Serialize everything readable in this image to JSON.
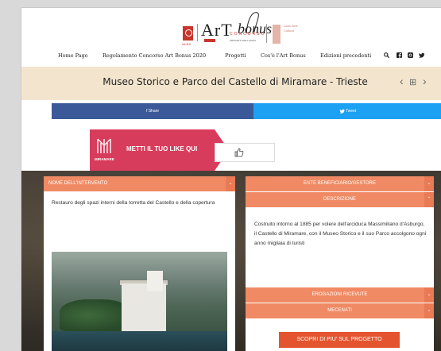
{
  "header": {
    "ales_text": "ALES",
    "art_text": "ArT",
    "bonus_text": "bonus",
    "concorso_text": "CONCORSO",
    "concorso_sub": "PROGETTI DELL'ANNO",
    "side_text": "Lazio Arte Cultura"
  },
  "nav": {
    "items": [
      {
        "label": "Home Page"
      },
      {
        "label": "Regolamento Concorso Art Bonus 2020"
      },
      {
        "label": "Progetti"
      },
      {
        "label": "Cos'è l'Art Bonus"
      },
      {
        "label": "Edizioni precedenti"
      }
    ],
    "icons": [
      "search-icon",
      "facebook-icon",
      "instagram-icon",
      "twitter-icon"
    ]
  },
  "title": {
    "text": "Museo Storico e Parco del Castello di Miramare - Trieste",
    "prev_symbol": "‹",
    "grid_symbol": "⊞",
    "next_symbol": "›"
  },
  "share": {
    "facebook": "f  Share",
    "twitter": "Tweet"
  },
  "like": {
    "logo_text": "MIRAMARE",
    "label": "METTI IL TUO LIKE QUI",
    "thumb": "👍"
  },
  "left_card": {
    "header": "NOME DELL'INTERVENTO",
    "body": "Restauro degli spazi interni della torretta del Castello e della copertura"
  },
  "right_card": {
    "beneficiario": "ENTE BENEFICIARIO/GESTORE",
    "descrizione": "DESCRIZIONE",
    "body": "Costruito intorno al 1885 per volere dell'arciduca Massimiliano d'Asburgo, il Castello di Miramare, con il Museo Storico e il suo Parco accolgono ogni anno migliaia di turisti",
    "erogazioni": "EROGAZIONI RICEVUTE",
    "mecenati": "MECENATI",
    "cta": "SCOPRI DI PIU' SUL PROGETTO"
  },
  "colors": {
    "accent": "#f08a64",
    "cta": "#e4552f",
    "like": "#d83c5c",
    "facebook": "#3b5998",
    "twitter": "#1da1f2",
    "title_bar": "#f3e5cd"
  }
}
